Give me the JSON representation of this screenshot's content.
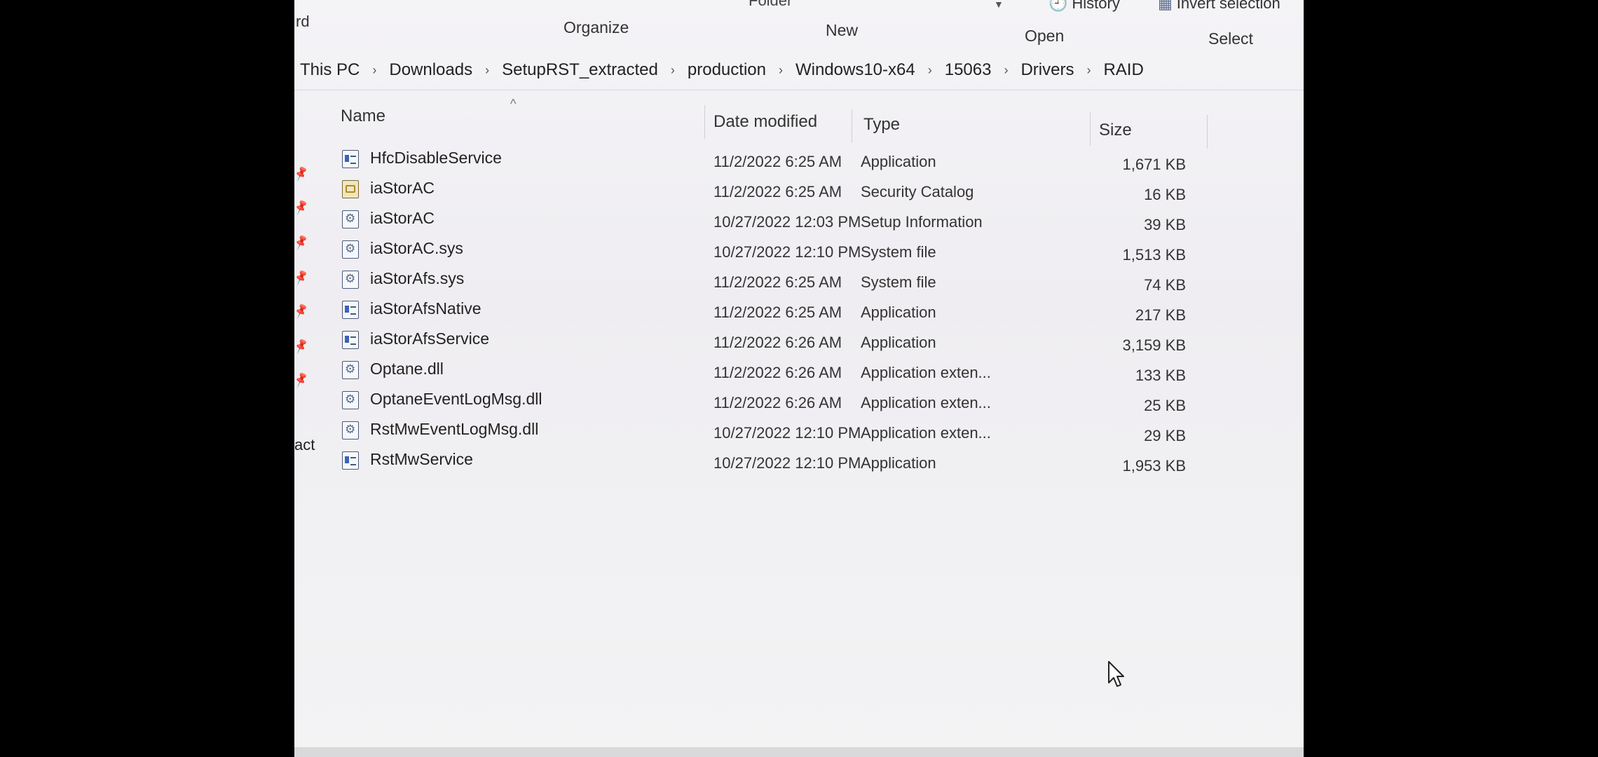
{
  "ribbon": {
    "clipped_left": "rd",
    "folder_label": "Folder",
    "history_label": "History",
    "invert_selection_label": "Invert selection",
    "groups": {
      "organize": "Organize",
      "new": "New",
      "open": "Open",
      "select": "Select"
    }
  },
  "breadcrumb": [
    "This PC",
    "Downloads",
    "SetupRST_extracted",
    "production",
    "Windows10-x64",
    "15063",
    "Drivers",
    "RAID"
  ],
  "columns": {
    "name": "Name",
    "date_modified": "Date modified",
    "type": "Type",
    "size": "Size"
  },
  "files": [
    {
      "name": "HfcDisableService",
      "date": "11/2/2022 6:25 AM",
      "type": "Application",
      "size": "1,671 KB",
      "icon": "app-icon"
    },
    {
      "name": "iaStorAC",
      "date": "11/2/2022 6:25 AM",
      "type": "Security Catalog",
      "size": "16 KB",
      "icon": "catalog-icon"
    },
    {
      "name": "iaStorAC",
      "date": "10/27/2022 12:03 PM",
      "type": "Setup Information",
      "size": "39 KB",
      "icon": "setup-info-icon"
    },
    {
      "name": "iaStorAC.sys",
      "date": "10/27/2022 12:10 PM",
      "type": "System file",
      "size": "1,513 KB",
      "icon": "system-file-icon"
    },
    {
      "name": "iaStorAfs.sys",
      "date": "11/2/2022 6:25 AM",
      "type": "System file",
      "size": "74 KB",
      "icon": "system-file-icon"
    },
    {
      "name": "iaStorAfsNative",
      "date": "11/2/2022 6:25 AM",
      "type": "Application",
      "size": "217 KB",
      "icon": "app-icon"
    },
    {
      "name": "iaStorAfsService",
      "date": "11/2/2022 6:26 AM",
      "type": "Application",
      "size": "3,159 KB",
      "icon": "app-icon"
    },
    {
      "name": "Optane.dll",
      "date": "11/2/2022 6:26 AM",
      "type": "Application exten...",
      "size": "133 KB",
      "icon": "dll-icon"
    },
    {
      "name": "OptaneEventLogMsg.dll",
      "date": "11/2/2022 6:26 AM",
      "type": "Application exten...",
      "size": "25 KB",
      "icon": "dll-icon"
    },
    {
      "name": "RstMwEventLogMsg.dll",
      "date": "10/27/2022 12:10 PM",
      "type": "Application exten...",
      "size": "29 KB",
      "icon": "dll-icon"
    },
    {
      "name": "RstMwService",
      "date": "10/27/2022 12:10 PM",
      "type": "Application",
      "size": "1,953 KB",
      "icon": "app-icon"
    }
  ],
  "side_pane": {
    "clipped_item": "act"
  }
}
